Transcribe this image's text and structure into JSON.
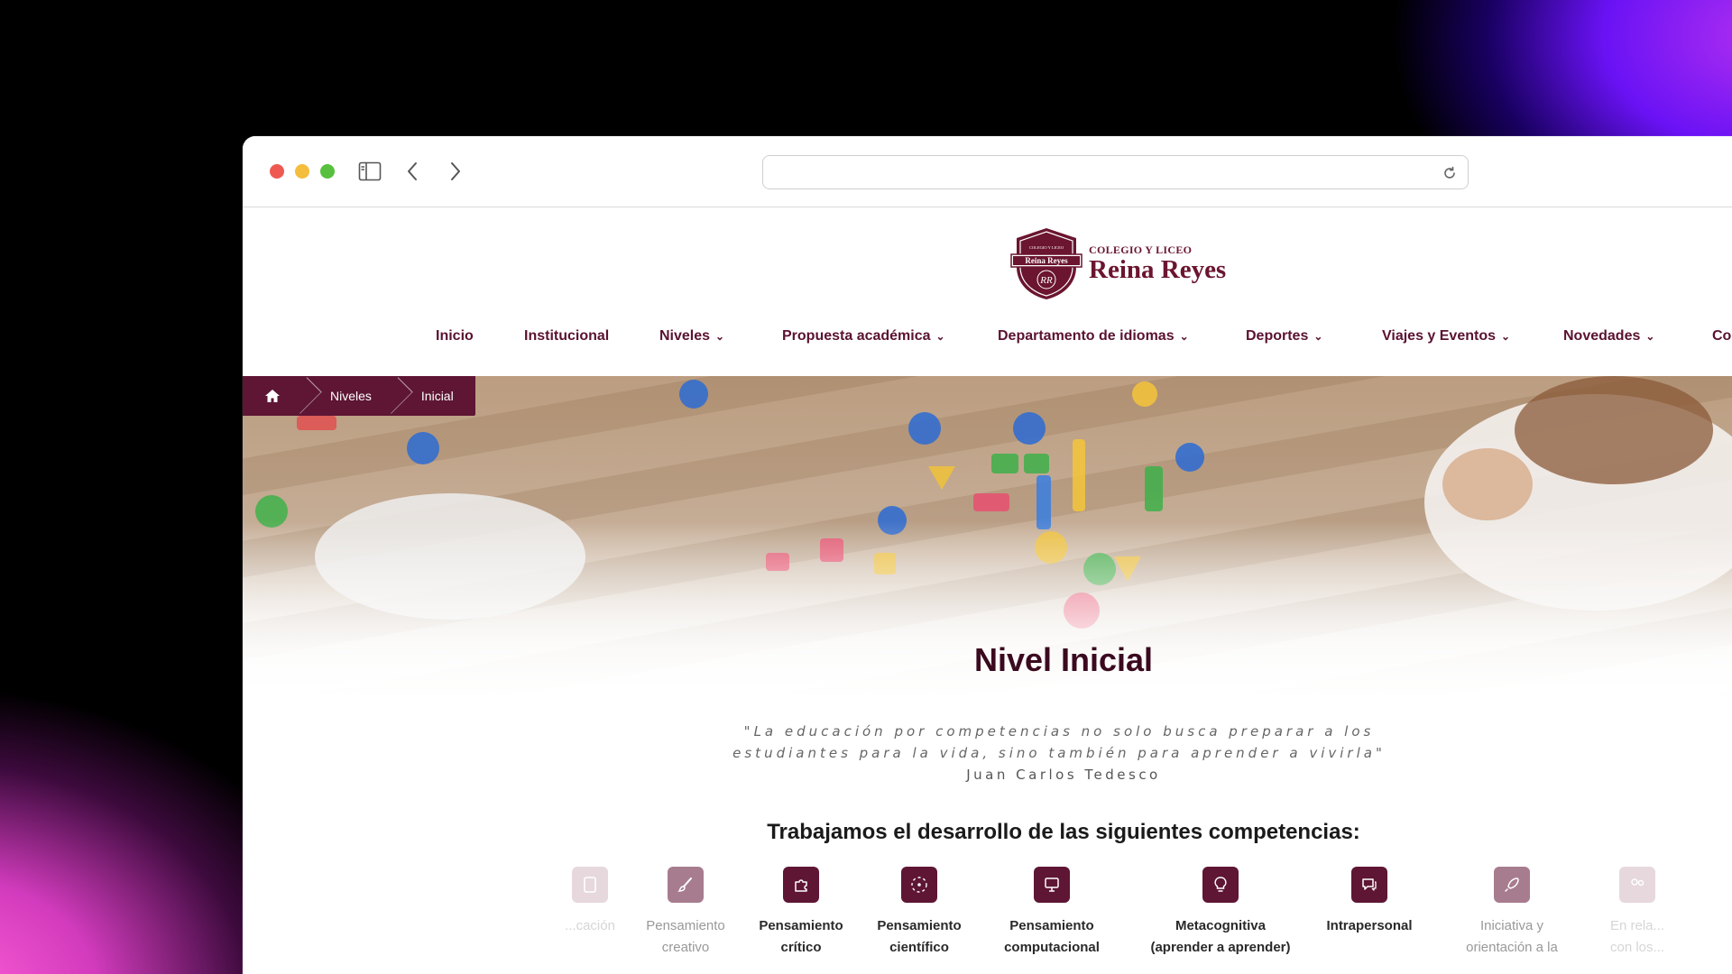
{
  "browser": {
    "url_value": "",
    "icons": [
      "sidebar-icon",
      "back-icon",
      "forward-icon",
      "reload-icon"
    ]
  },
  "site": {
    "logo": {
      "small_text": "COLEGIO Y LICEO",
      "big_text": "Reina Reyes",
      "crest_top": "COLEGIO Y LICEO",
      "crest_band": "Reina Reyes",
      "crest_mono": "RR"
    },
    "nav": [
      {
        "label": "Inicio",
        "dropdown": false
      },
      {
        "label": "Institucional",
        "dropdown": false
      },
      {
        "label": "Niveles",
        "dropdown": true
      },
      {
        "label": "Propuesta académica",
        "dropdown": true
      },
      {
        "label": "Departamento de idiomas",
        "dropdown": true
      },
      {
        "label": "Deportes",
        "dropdown": true
      },
      {
        "label": "Viajes y Eventos",
        "dropdown": true
      },
      {
        "label": "Novedades",
        "dropdown": true
      },
      {
        "label": "Co",
        "dropdown": false
      }
    ]
  },
  "breadcrumb": {
    "items": [
      "Niveles",
      "Inicial"
    ]
  },
  "hero": {
    "title": "Nivel Inicial"
  },
  "quote": {
    "text": "\"La educación por competencias no solo busca preparar a los estudiantes para la vida, sino también para aprender a vivirla\"",
    "author": "Juan Carlos Tedesco"
  },
  "competencies": {
    "heading": "Trabajamos el desarrollo de las siguientes competencias:",
    "items": [
      {
        "line1": "...cación",
        "line2": "",
        "icon": "document-icon",
        "state": "faded2"
      },
      {
        "line1": "Pensamiento",
        "line2": "creativo",
        "icon": "brush-icon",
        "state": "faded"
      },
      {
        "line1": "Pensamiento",
        "line2": "crítico",
        "icon": "puzzle-icon",
        "state": "active"
      },
      {
        "line1": "Pensamiento",
        "line2": "científico",
        "icon": "atom-icon",
        "state": "active"
      },
      {
        "line1": "Pensamiento",
        "line2": "computacional",
        "icon": "monitor-icon",
        "state": "active"
      },
      {
        "line1": "Metacognitiva",
        "line2": "(aprender a aprender)",
        "icon": "lightbulb-icon",
        "state": "active"
      },
      {
        "line1": "Intrapersonal",
        "line2": "",
        "icon": "chat-icon",
        "state": "active"
      },
      {
        "line1": "Iniciativa y",
        "line2": "orientación a la",
        "icon": "rocket-icon",
        "state": "faded"
      },
      {
        "line1": "En rela...",
        "line2": "con los...",
        "icon": "people-icon",
        "state": "faded2"
      }
    ]
  }
}
